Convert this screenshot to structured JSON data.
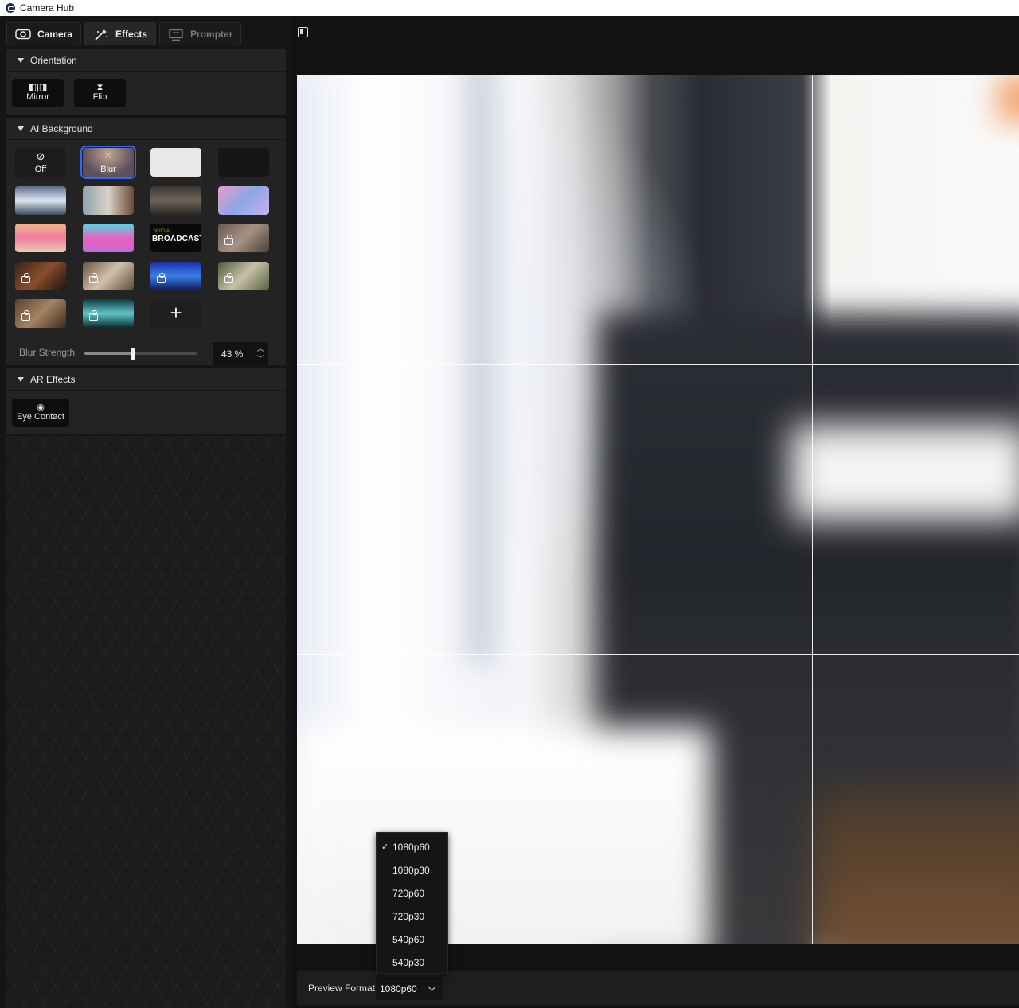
{
  "window": {
    "title": "Camera Hub"
  },
  "tabs": [
    {
      "label": "Camera",
      "icon": "camera-icon"
    },
    {
      "label": "Effects",
      "icon": "magic-wand-icon"
    },
    {
      "label": "Prompter",
      "icon": "prompter-icon"
    }
  ],
  "orientation": {
    "title": "Orientation",
    "buttons": [
      {
        "label": "Mirror",
        "icon": "mirror-icon"
      },
      {
        "label": "Flip",
        "icon": "flip-icon"
      }
    ]
  },
  "ai_background": {
    "title": "AI Background",
    "off_label": "Off",
    "blur_label": "Blur",
    "broadcast_label": "BROADCAST",
    "nvidia_label": "NVIDIA",
    "blur_strength_label": "Blur Strength",
    "blur_strength_value": "43 %",
    "blur_strength_fraction": 0.43
  },
  "ar_effects": {
    "title": "AR Effects",
    "eye_contact_label": "Eye Contact"
  },
  "preview": {
    "format_label": "Preview Format",
    "format_value": "1080p60",
    "format_options": [
      "1080p60",
      "1080p30",
      "720p60",
      "720p30",
      "540p60",
      "540p30"
    ],
    "selected_option": "1080p60"
  },
  "colors": {
    "accent": "#2f67ff",
    "panel": "#232323",
    "background": "#121212"
  }
}
